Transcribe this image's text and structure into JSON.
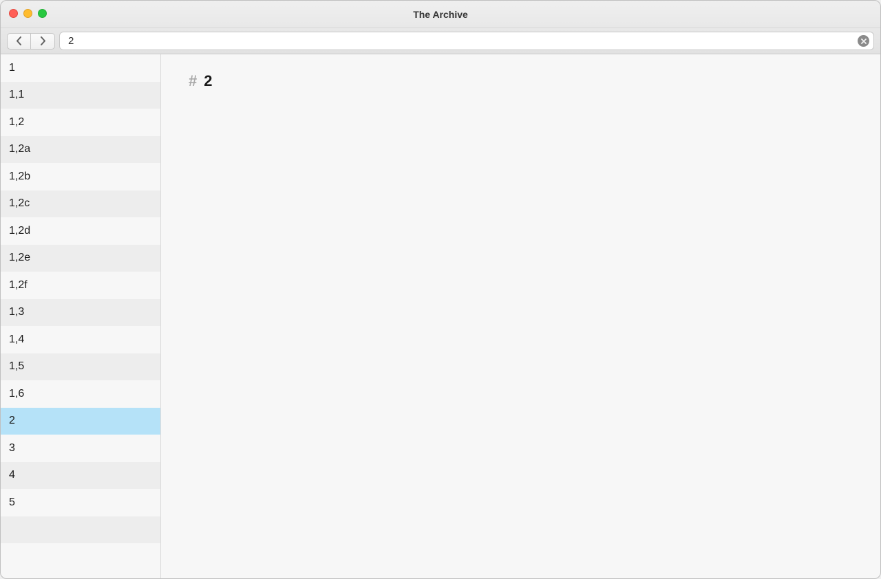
{
  "window": {
    "title": "The Archive"
  },
  "search": {
    "value": "2"
  },
  "sidebar": {
    "items": [
      {
        "label": "1",
        "selected": false
      },
      {
        "label": "1,1",
        "selected": false
      },
      {
        "label": "1,2",
        "selected": false
      },
      {
        "label": "1,2a",
        "selected": false
      },
      {
        "label": "1,2b",
        "selected": false
      },
      {
        "label": "1,2c",
        "selected": false
      },
      {
        "label": "1,2d",
        "selected": false
      },
      {
        "label": "1,2e",
        "selected": false
      },
      {
        "label": "1,2f",
        "selected": false
      },
      {
        "label": "1,3",
        "selected": false
      },
      {
        "label": "1,4",
        "selected": false
      },
      {
        "label": "1,5",
        "selected": false
      },
      {
        "label": "1,6",
        "selected": false
      },
      {
        "label": "2",
        "selected": true
      },
      {
        "label": "3",
        "selected": false
      },
      {
        "label": "4",
        "selected": false
      },
      {
        "label": "5",
        "selected": false
      },
      {
        "label": "",
        "selected": false
      },
      {
        "label": "",
        "selected": false
      }
    ]
  },
  "editor": {
    "hash": "#",
    "heading": "2"
  }
}
